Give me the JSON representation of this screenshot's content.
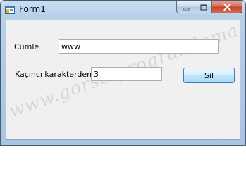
{
  "window": {
    "title": "Form1"
  },
  "form": {
    "word_label": "Cümle",
    "word_value": "www",
    "index_label": "Kaçıncı karakterden",
    "index_value": "3",
    "delete_button": "Sil"
  },
  "watermark": {
    "text": "www.gorselprogramlama.com"
  },
  "icons": {
    "app": "windows-form-icon",
    "minimize": "minimize-icon",
    "maximize": "maximize-icon",
    "close": "close-icon"
  }
}
